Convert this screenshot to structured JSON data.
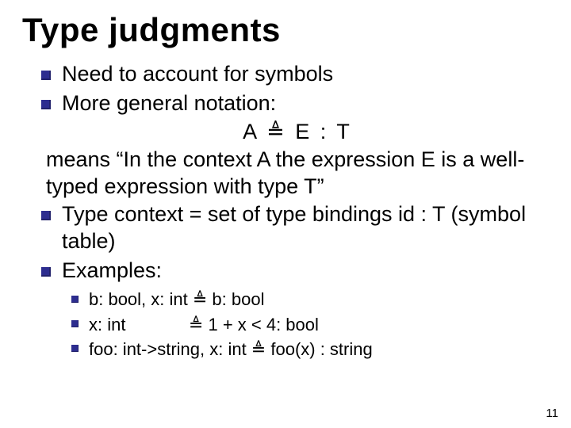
{
  "title": "Type judgments",
  "bullets": {
    "b1": "Need to account for symbols",
    "b2": "More general notation:",
    "b2_center": "A ≜ E : T",
    "b2_cont": "means “In the context A the expression E is a well-typed expression with type T”",
    "b3": "Type context = set of type bindings id : T (symbol table)",
    "b4": "Examples:"
  },
  "examples": {
    "e1": "b: bool, x: int ≜ b: bool",
    "e2": "x: int             ≜ 1 + x < 4: bool",
    "e3": "foo: int->string, x: int ≜ foo(x) : string"
  },
  "page_number": "11"
}
